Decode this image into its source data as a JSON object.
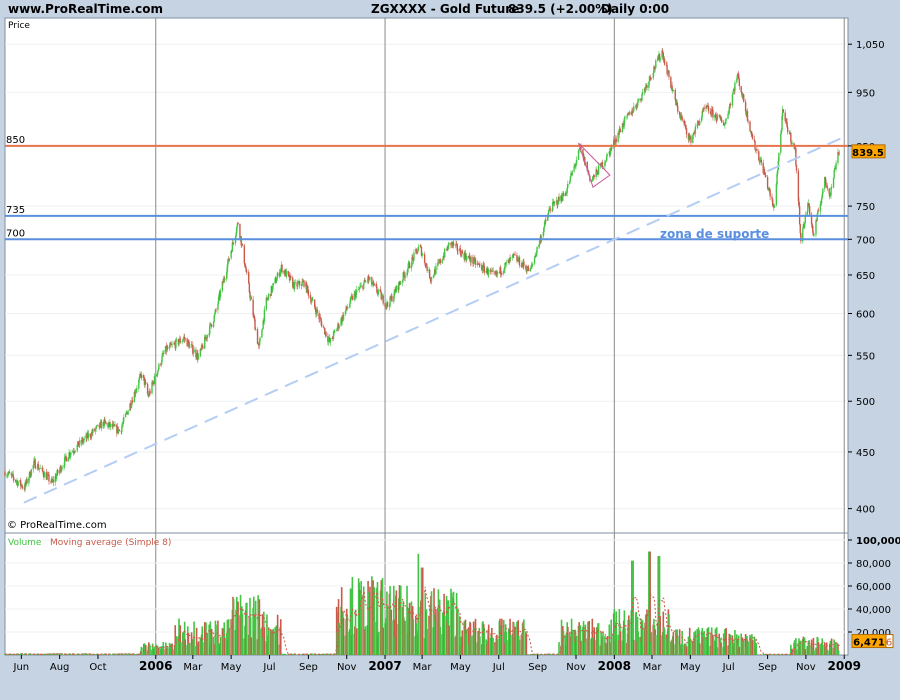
{
  "header": {
    "site": "www.ProRealTime.com",
    "instrument": "ZGXXXX - Gold Future",
    "last": "839.5 (+2.00%)",
    "timeframe": "Daily  0:00"
  },
  "price_panel": {
    "label": "Price",
    "copyright": "© ProRealTime.com",
    "current_badge": "839.5"
  },
  "volume_panel": {
    "label_volume": "Volume",
    "label_ma": "Moving average (Simple 8)",
    "current_badge": "6,471",
    "badge_suffix": "6"
  },
  "annotation": {
    "text": "zona de suporte"
  },
  "colors": {
    "background": "#c5d3e3",
    "panel": "#ffffff",
    "up": "#44c444",
    "down": "#c85a4a",
    "resistance": "#e8734a",
    "support": "#5a8fe0",
    "trendline": "#b4cdf5",
    "badge": "#ffa500"
  },
  "chart_data": [
    {
      "type": "candlestick",
      "title": "ZGXXXX - Gold Future",
      "ylabel": "Price",
      "y_scale": "log",
      "ylim": [
        385,
        1095
      ],
      "y_ticks": [
        400,
        450,
        500,
        550,
        600,
        650,
        700,
        750,
        850,
        950,
        1050
      ],
      "y_tick_labels": [
        "400",
        "450",
        "500",
        "550",
        "600",
        "650",
        "700",
        "750",
        "850",
        "950",
        "1,050"
      ],
      "x_range": [
        "2005-05-06",
        "2009-01-07"
      ],
      "x_ticks": [
        {
          "date": "2005-06-01",
          "label": "Jun"
        },
        {
          "date": "2005-08-01",
          "label": "Aug"
        },
        {
          "date": "2005-10-01",
          "label": "Oct"
        },
        {
          "date": "2006-01-01",
          "label": "2006",
          "bold": true
        },
        {
          "date": "2006-03-01",
          "label": "Mar"
        },
        {
          "date": "2006-05-01",
          "label": "May"
        },
        {
          "date": "2006-07-01",
          "label": "Jul"
        },
        {
          "date": "2006-09-01",
          "label": "Sep"
        },
        {
          "date": "2006-11-01",
          "label": "Nov"
        },
        {
          "date": "2007-01-01",
          "label": "2007",
          "bold": true
        },
        {
          "date": "2007-03-01",
          "label": "Mar"
        },
        {
          "date": "2007-05-01",
          "label": "May"
        },
        {
          "date": "2007-07-01",
          "label": "Jul"
        },
        {
          "date": "2007-09-01",
          "label": "Sep"
        },
        {
          "date": "2007-11-01",
          "label": "Nov"
        },
        {
          "date": "2008-01-01",
          "label": "2008",
          "bold": true
        },
        {
          "date": "2008-03-01",
          "label": "Mar"
        },
        {
          "date": "2008-05-01",
          "label": "May"
        },
        {
          "date": "2008-07-01",
          "label": "Jul"
        },
        {
          "date": "2008-09-01",
          "label": "Sep"
        },
        {
          "date": "2008-11-01",
          "label": "Nov"
        },
        {
          "date": "2009-01-01",
          "label": "2009",
          "bold": true
        }
      ],
      "price_path": [
        [
          "2005-05-06",
          432
        ],
        [
          "2005-06-06",
          418
        ],
        [
          "2005-06-22",
          440
        ],
        [
          "2005-07-20",
          422
        ],
        [
          "2005-08-15",
          448
        ],
        [
          "2005-09-10",
          462
        ],
        [
          "2005-10-10",
          478
        ],
        [
          "2005-11-05",
          470
        ],
        [
          "2005-12-10",
          530
        ],
        [
          "2005-12-20",
          505
        ],
        [
          "2006-01-15",
          555
        ],
        [
          "2006-02-15",
          570
        ],
        [
          "2006-03-10",
          548
        ],
        [
          "2006-04-05",
          598
        ],
        [
          "2006-05-12",
          725
        ],
        [
          "2006-06-14",
          558
        ],
        [
          "2006-06-26",
          615
        ],
        [
          "2006-07-20",
          660
        ],
        [
          "2006-08-10",
          635
        ],
        [
          "2006-08-25",
          640
        ],
        [
          "2006-10-05",
          565
        ],
        [
          "2006-11-10",
          620
        ],
        [
          "2006-12-05",
          645
        ],
        [
          "2007-01-05",
          610
        ],
        [
          "2007-02-25",
          690
        ],
        [
          "2007-03-15",
          645
        ],
        [
          "2007-04-15",
          695
        ],
        [
          "2007-05-10",
          675
        ],
        [
          "2007-06-25",
          648
        ],
        [
          "2007-07-25",
          675
        ],
        [
          "2007-08-20",
          655
        ],
        [
          "2007-09-20",
          745
        ],
        [
          "2007-10-15",
          770
        ],
        [
          "2007-11-08",
          845
        ],
        [
          "2007-11-25",
          790
        ],
        [
          "2007-12-20",
          830
        ],
        [
          "2008-01-15",
          890
        ],
        [
          "2008-02-10",
          935
        ],
        [
          "2008-03-17",
          1035
        ],
        [
          "2008-04-10",
          920
        ],
        [
          "2008-05-01",
          860
        ],
        [
          "2008-05-25",
          920
        ],
        [
          "2008-06-25",
          890
        ],
        [
          "2008-07-15",
          985
        ],
        [
          "2008-08-10",
          855
        ],
        [
          "2008-08-25",
          810
        ],
        [
          "2008-09-11",
          745
        ],
        [
          "2008-09-25",
          910
        ],
        [
          "2008-10-15",
          840
        ],
        [
          "2008-10-24",
          700
        ],
        [
          "2008-11-05",
          755
        ],
        [
          "2008-11-13",
          705
        ],
        [
          "2008-12-01",
          790
        ],
        [
          "2008-12-10",
          770
        ],
        [
          "2008-12-22",
          840
        ]
      ],
      "lines": [
        {
          "kind": "horizontal",
          "value": 850,
          "label": "850",
          "color": "#e8734a"
        },
        {
          "kind": "horizontal",
          "value": 735,
          "label": "735",
          "color": "#5a8fe0"
        },
        {
          "kind": "horizontal",
          "value": 700,
          "label": "700",
          "color": "#5a8fe0"
        },
        {
          "kind": "trendline",
          "from": [
            "2005-06-05",
            405
          ],
          "to": [
            "2009-01-05",
            868
          ],
          "style": "dashed",
          "color": "#b4cdf5"
        }
      ],
      "triangle": [
        [
          "2007-11-05",
          855
        ],
        [
          "2007-12-25",
          800
        ],
        [
          "2007-11-28",
          780
        ]
      ],
      "last_price": 839.5
    },
    {
      "type": "bar",
      "title": "Volume",
      "overlay": "Moving average (Simple 8)",
      "ylim": [
        0,
        100000
      ],
      "y_ticks": [
        20000,
        40000,
        60000,
        80000,
        100000
      ],
      "y_tick_labels": [
        "20,000",
        "40,000",
        "60,000",
        "80,000",
        "100,000"
      ],
      "volume_segments": [
        [
          "2005-05-06",
          "2005-12-08",
          1000
        ],
        [
          "2005-12-08",
          "2006-02-01",
          8000
        ],
        [
          "2006-02-01",
          "2006-05-01",
          22000
        ],
        [
          "2006-05-01",
          "2006-06-25",
          38000
        ],
        [
          "2006-06-25",
          "2006-07-20",
          25000
        ],
        [
          "2006-07-20",
          "2006-10-15",
          900
        ],
        [
          "2006-10-15",
          "2006-12-31",
          48000
        ],
        [
          "2006-12-31",
          "2007-05-01",
          42000
        ],
        [
          "2007-05-01",
          "2007-08-15",
          22000
        ],
        [
          "2007-08-15",
          "2007-10-05",
          800
        ],
        [
          "2007-10-05",
          "2007-12-28",
          22000
        ],
        [
          "2007-12-28",
          "2008-04-01",
          28000
        ],
        [
          "2008-04-01",
          "2008-07-15",
          17000
        ],
        [
          "2008-07-15",
          "2008-08-15",
          15000
        ],
        [
          "2008-08-15",
          "2008-10-08",
          700
        ],
        [
          "2008-10-08",
          "2008-12-24",
          11000
        ]
      ],
      "spikes": [
        [
          "2007-02-24",
          88000
        ],
        [
          "2007-03-01",
          76000
        ],
        [
          "2008-01-30",
          82000
        ],
        [
          "2008-02-26",
          90000
        ],
        [
          "2008-03-12",
          86000
        ]
      ],
      "last_volume": 6471
    }
  ]
}
